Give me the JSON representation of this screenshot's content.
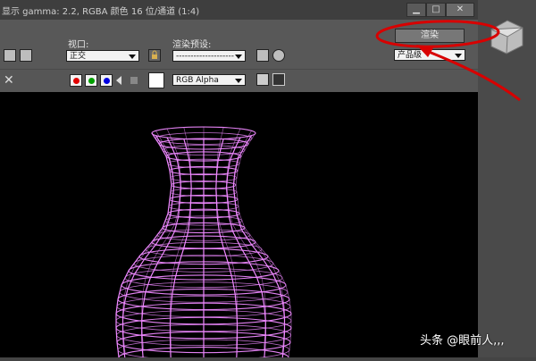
{
  "window": {
    "title": "显示 gamma: 2.2, RGBA 颜色 16 位/通道 (1:4)",
    "minimize_glyph": "▁",
    "maximize_glyph": "□",
    "close_glyph": "✕"
  },
  "toolbar": {
    "viewport_label": "视口:",
    "viewport_value": "正交",
    "preset_label": "渲染预设:",
    "preset_value": "--------------------",
    "render_button": "渲染",
    "product_level_value": "产品级"
  },
  "channels": {
    "close_glyph": "✕",
    "alpha_mode_value": "RGB Alpha",
    "red_color": "#e00000",
    "green_color": "#00a000",
    "blue_color": "#0000e0"
  },
  "wireframe_color": "#ee88ff",
  "annotation_color": "#d80000",
  "watermark": "头条 @眼前人,,,"
}
